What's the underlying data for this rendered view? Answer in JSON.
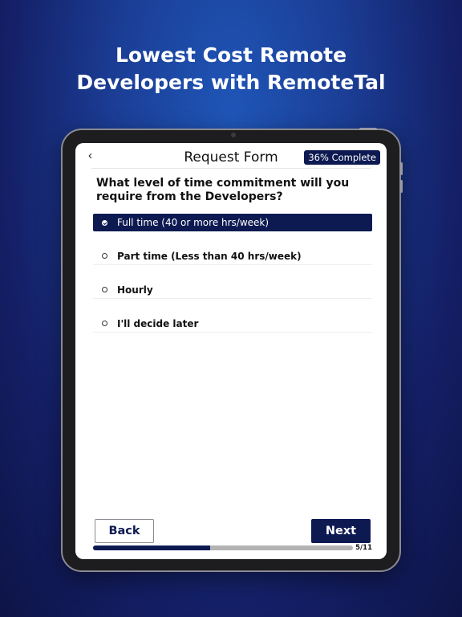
{
  "headline": {
    "line1": "Lowest Cost Remote",
    "line2": "Developers with RemoteTal"
  },
  "form": {
    "back_icon": "chevron-left-icon",
    "title": "Request Form",
    "progress_badge": "36% Complete",
    "question": "What level of time commitment will you require from the Developers?",
    "options": [
      {
        "label": "Full time (40 or more hrs/week)",
        "selected": true
      },
      {
        "label": "Part time (Less than 40 hrs/week)",
        "selected": false
      },
      {
        "label": "Hourly",
        "selected": false
      },
      {
        "label": "I'll decide later",
        "selected": false
      }
    ],
    "back_label": "Back",
    "next_label": "Next",
    "progress_fraction": 0.45,
    "step_count": "5/11"
  },
  "colors": {
    "accent": "#0d1a52",
    "background_top": "#1f56b8",
    "background_bottom": "#0e1446"
  }
}
